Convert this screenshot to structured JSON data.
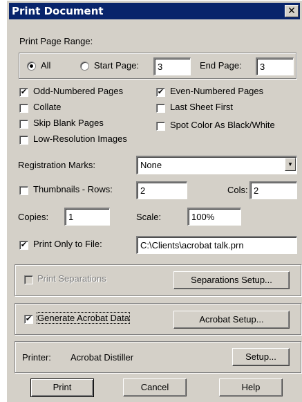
{
  "dialog": {
    "title": "Print Document",
    "close_glyph": "✕"
  },
  "range": {
    "group_label": "Print Page Range:",
    "all_label": "All",
    "all_selected": true,
    "start_label": "Start Page:",
    "start_value": "3",
    "end_label": "End Page:",
    "end_value": "3"
  },
  "options": {
    "odd": {
      "label": "Odd-Numbered Pages",
      "checked": true
    },
    "even": {
      "label": "Even-Numbered Pages",
      "checked": true
    },
    "collate": {
      "label": "Collate",
      "checked": false
    },
    "last_sheet": {
      "label": "Last Sheet First",
      "checked": false
    },
    "skip_blank": {
      "label": "Skip Blank Pages",
      "checked": false
    },
    "spot_color": {
      "label": "Spot Color As Black/White",
      "checked": false
    },
    "low_res": {
      "label": "Low-Resolution Images",
      "checked": false
    }
  },
  "registration": {
    "label": "Registration Marks:",
    "value": "None"
  },
  "thumbnails": {
    "label": "Thumbnails - Rows:",
    "checked": false,
    "rows_value": "2",
    "cols_label": "Cols:",
    "cols_value": "2"
  },
  "copies": {
    "label": "Copies:",
    "value": "1"
  },
  "scale": {
    "label": "Scale:",
    "value": "100%"
  },
  "print_to_file": {
    "label": "Print Only to File:",
    "checked": true,
    "value": "C:\\Clients\\acrobat talk.prn"
  },
  "separations": {
    "label": "Print Separations",
    "checked": false,
    "setup_label": "Separations Setup..."
  },
  "acrobat": {
    "label": "Generate Acrobat Data",
    "checked": true,
    "setup_label": "Acrobat Setup..."
  },
  "printer": {
    "label": "Printer:",
    "name": "Acrobat Distiller",
    "setup_label": "Setup..."
  },
  "buttons": {
    "print": "Print",
    "cancel": "Cancel",
    "help": "Help"
  },
  "colors": {
    "titlebar": "#08246b",
    "face": "#d4d0c8"
  }
}
